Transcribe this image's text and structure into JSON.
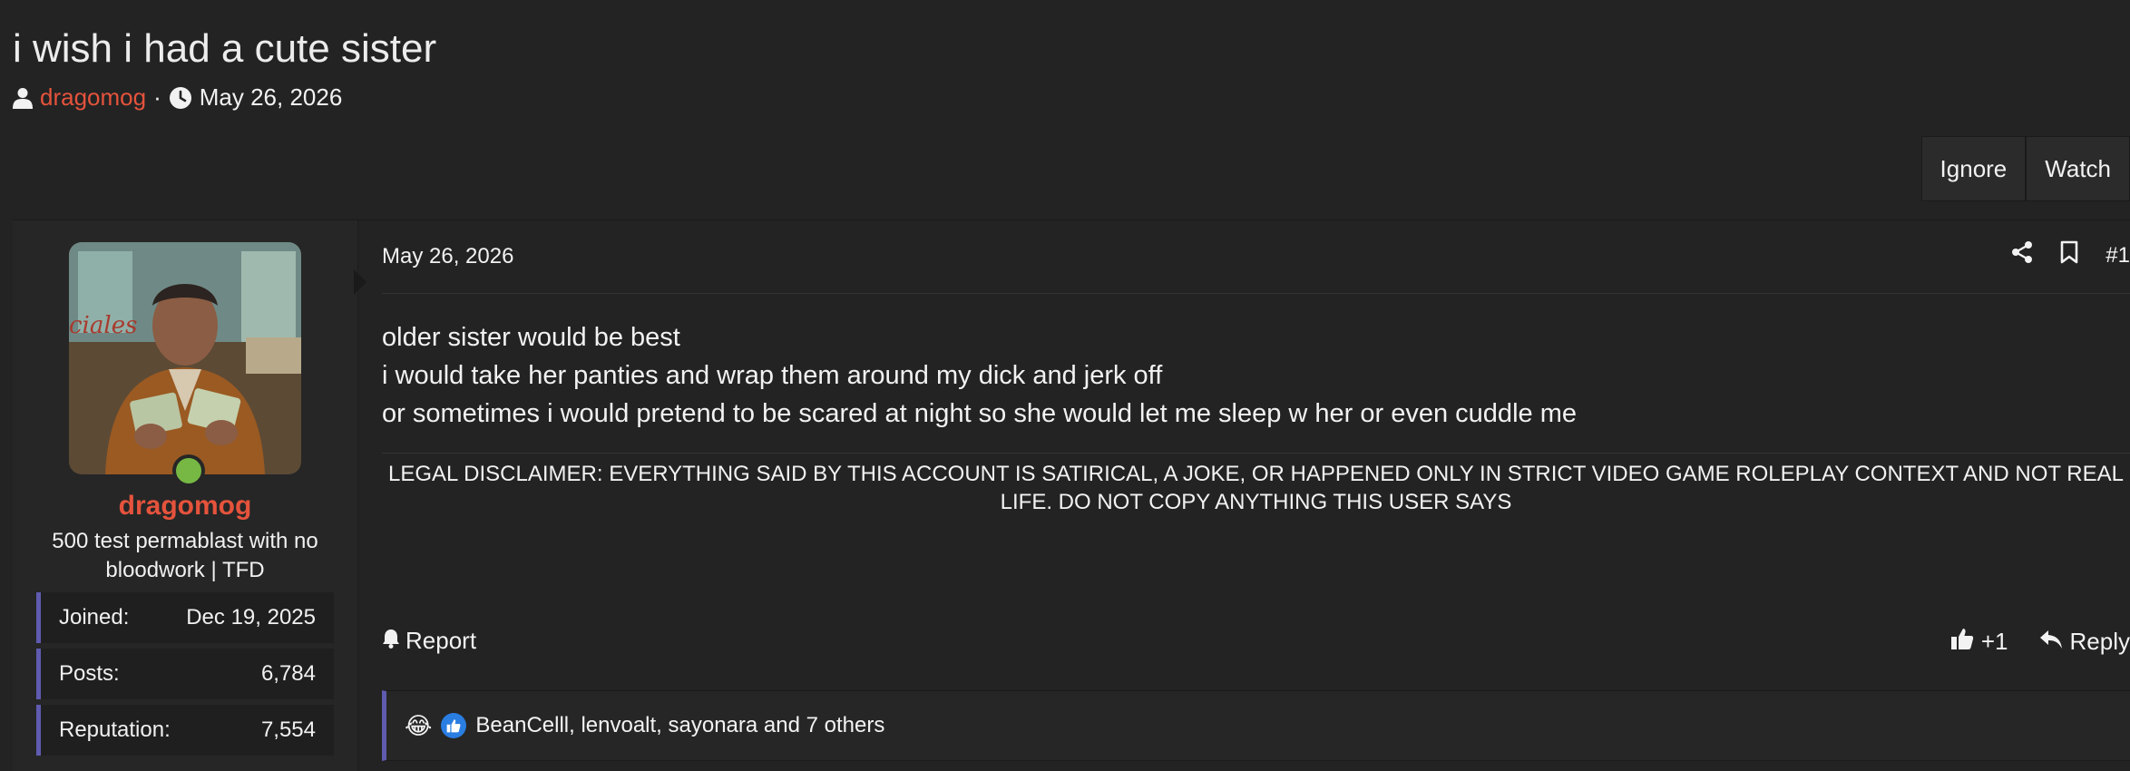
{
  "thread": {
    "title": "i wish i had a cute sister",
    "author": "dragomog",
    "separator": "·",
    "date": "May 26, 2026",
    "actions": {
      "ignore": "Ignore",
      "watch": "Watch"
    }
  },
  "user": {
    "name": "dragomog",
    "title": "500 test permablast with no bloodwork | TFD",
    "stats": [
      {
        "label": "Joined:",
        "value": "Dec 19, 2025"
      },
      {
        "label": "Posts:",
        "value": "6,784"
      },
      {
        "label": "Reputation:",
        "value": "7,554"
      }
    ],
    "status_color": "#76b843"
  },
  "post": {
    "date": "May 26, 2026",
    "number": "#1",
    "body": [
      "older sister would be best",
      "i would take her panties and wrap them around my dick and jerk off",
      "or sometimes i would pretend to be scared at night so she would let me sleep w her or even cuddle me"
    ],
    "disclaimer": "LEGAL DISCLAIMER: EVERYTHING SAID BY THIS ACCOUNT IS SATIRICAL, A JOKE, OR HAPPENED ONLY IN STRICT VIDEO GAME ROLEPLAY CONTEXT AND NOT REAL LIFE. DO NOT COPY ANYTHING THIS USER SAYS",
    "report_label": "Report",
    "like_label": "+1",
    "reply_label": "Reply",
    "reactions_text": "BeanCelll, lenvoalt, sayonara and 7 others",
    "reaction_emoji": "😂"
  },
  "colors": {
    "accent": "#e5533c",
    "background": "#232323",
    "stat_border": "#5f5bb0"
  }
}
